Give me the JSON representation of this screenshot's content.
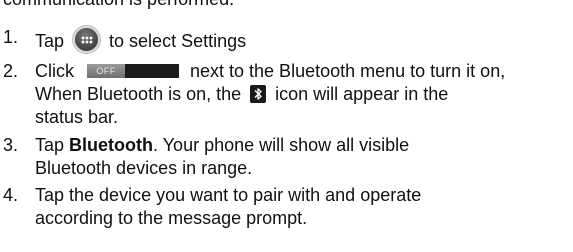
{
  "intro_text": "communication is performed.",
  "steps": [
    {
      "number": "1.",
      "before_icon": "Tap",
      "icon": "apps-icon",
      "after_icon": "to select Settings"
    },
    {
      "number": "2.",
      "before_toggle": "Click",
      "toggle_label": "OFF",
      "after_toggle": "next to the Bluetooth menu to turn it on,",
      "line2_before_icon": "When Bluetooth is on, the",
      "icon": "bluetooth-icon",
      "line2_after_icon": "icon will appear in the",
      "line3": "status bar."
    },
    {
      "number": "3.",
      "prefix": "Tap",
      "bold": "Bluetooth",
      "line1_rest": ". Your phone will show all visible",
      "line2": "Bluetooth devices in range."
    },
    {
      "number": "4.",
      "line1": "Tap the device you want to pair with and operate",
      "line2": "according to the message prompt."
    }
  ]
}
